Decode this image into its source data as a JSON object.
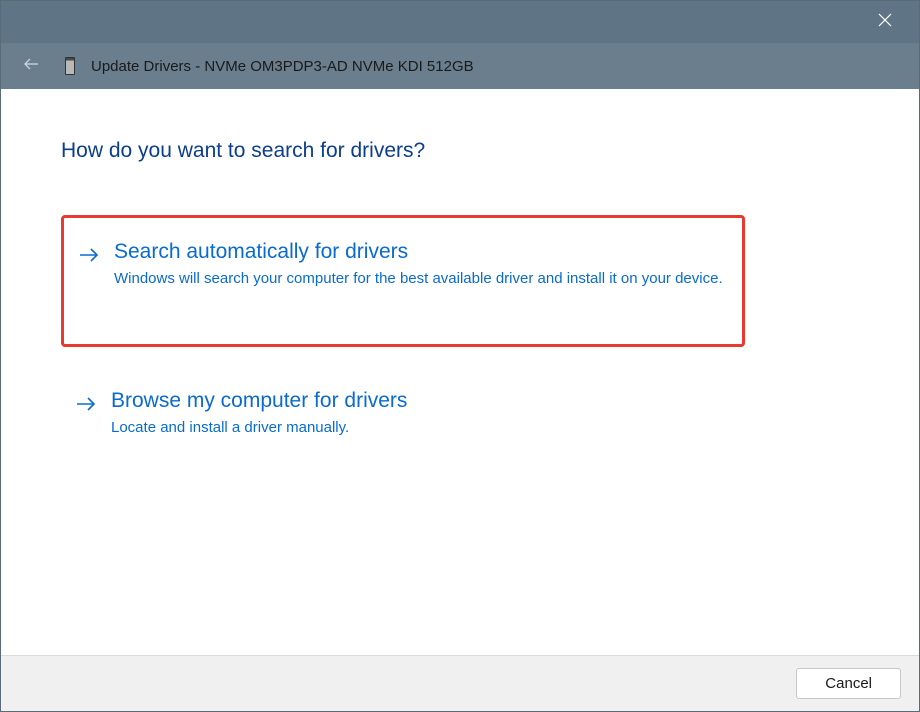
{
  "window": {
    "title": "Update Drivers - NVMe OM3PDP3-AD NVMe KDI 512GB"
  },
  "content": {
    "heading": "How do you want to search for drivers?",
    "options": [
      {
        "title": "Search automatically for drivers",
        "description": "Windows will search your computer for the best available driver and install it on your device."
      },
      {
        "title": "Browse my computer for drivers",
        "description": "Locate and install a driver manually."
      }
    ]
  },
  "footer": {
    "cancel_label": "Cancel"
  }
}
